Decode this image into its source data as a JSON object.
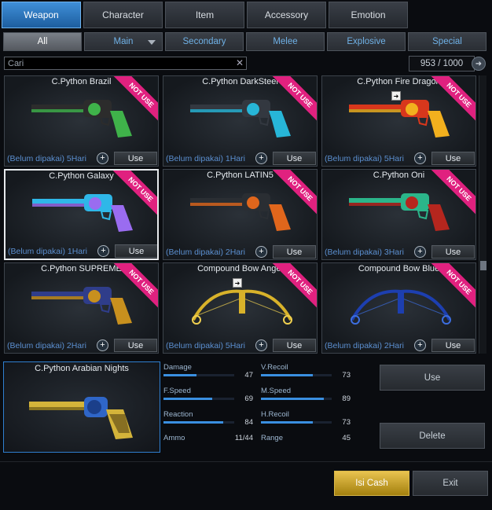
{
  "tabs": [
    "Weapon",
    "Character",
    "Item",
    "Accessory",
    "Emotion"
  ],
  "subtabs": [
    "All",
    "Main",
    "Secondary",
    "Melee",
    "Explosive",
    "Special"
  ],
  "search": {
    "value": "Cari"
  },
  "count": "953 / 1000",
  "ribbon_text": "NOT USE",
  "use_label": "Use",
  "items": [
    {
      "title": "C.Python Brazil",
      "status": "(Belum dipakai) 5Hari",
      "kind": "revolver",
      "c1": "#2c2c2c",
      "c2": "#3fb24a"
    },
    {
      "title": "C.Python DarkSteel",
      "status": "(Belum dipakai) 1Hari",
      "kind": "revolver",
      "c1": "#333840",
      "c2": "#27b6d8"
    },
    {
      "title": "C.Python Fire Dragon",
      "status": "(Belum dipakai) 5Hari",
      "kind": "revolver",
      "c1": "#d8371c",
      "c2": "#f2b01e"
    },
    {
      "title": "C.Python Galaxy",
      "status": "(Belum dipakai) 1Hari",
      "kind": "revolver",
      "c1": "#2fb7e8",
      "c2": "#9a6cf0"
    },
    {
      "title": "C.Python LATIN5",
      "status": "(Belum dipakai) 2Hari",
      "kind": "revolver",
      "c1": "#2a2e33",
      "c2": "#e0661c"
    },
    {
      "title": "C.Python Oni",
      "status": "(Belum dipakai) 3Hari",
      "kind": "revolver",
      "c1": "#2bb58a",
      "c2": "#b5261e"
    },
    {
      "title": "C.Python SUPREME",
      "status": "(Belum dipakai) 2Hari",
      "kind": "revolver",
      "c1": "#2f3d8a",
      "c2": "#c8901e"
    },
    {
      "title": "Compound Bow Angel",
      "status": "(Belum dipakai) 5Hari",
      "kind": "bow",
      "c1": "#d8b22a",
      "c2": "#f0d050"
    },
    {
      "title": "Compound Bow Blue",
      "status": "(Belum dipakai) 2Hari",
      "kind": "bow",
      "c1": "#1d3fb0",
      "c2": "#3c6ee0"
    }
  ],
  "detail": {
    "title": "C.Python Arabian Nights",
    "stats": [
      {
        "label": "Damage",
        "value": "47",
        "fill": 0.47
      },
      {
        "label": "V.Recoil",
        "value": "73",
        "fill": 0.73
      },
      {
        "label": "F.Speed",
        "value": "69",
        "fill": 0.69
      },
      {
        "label": "M.Speed",
        "value": "89",
        "fill": 0.89
      },
      {
        "label": "Reaction",
        "value": "84",
        "fill": 0.84
      },
      {
        "label": "H.Recoil",
        "value": "73",
        "fill": 0.73
      },
      {
        "label": "Ammo",
        "value": "11/44",
        "fill": null
      },
      {
        "label": "Range",
        "value": "45",
        "fill": null
      }
    ]
  },
  "buttons": {
    "use": "Use",
    "delete": "Delete",
    "cash": "Isi Cash",
    "exit": "Exit"
  }
}
